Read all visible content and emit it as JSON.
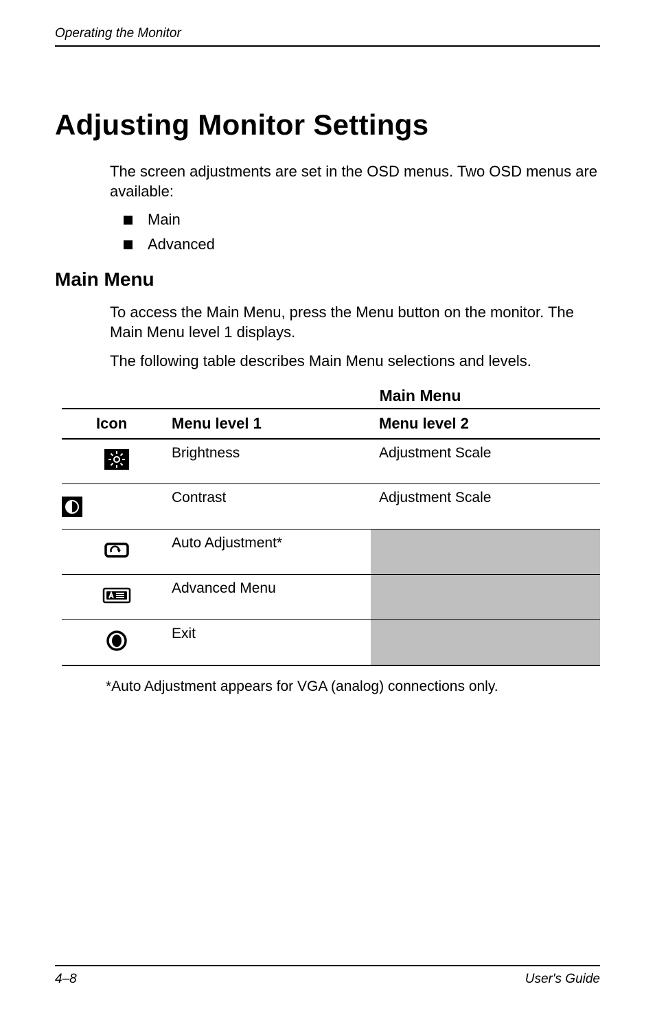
{
  "running_header": "Operating the Monitor",
  "h1": "Adjusting Monitor Settings",
  "intro": "The screen adjustments are set in the OSD menus. Two OSD menus are available:",
  "bullets": [
    "Main",
    "Advanced"
  ],
  "h2": "Main Menu",
  "main_para1": "To access the Main Menu, press the Menu button on the monitor. The Main Menu level 1 displays.",
  "main_para2": "The following table describes Main Menu selections and levels.",
  "table": {
    "title": "Main Menu",
    "headers": {
      "icon": "Icon",
      "level1": "Menu level 1",
      "level2": "Menu level 2"
    },
    "rows": [
      {
        "icon": "brightness",
        "level1": "Brightness",
        "level2": "Adjustment Scale"
      },
      {
        "icon": "contrast",
        "level1": "Contrast",
        "level2": "Adjustment Scale"
      },
      {
        "icon": "auto",
        "level1": "Auto Adjustment*",
        "level2": ""
      },
      {
        "icon": "advanced",
        "level1": "Advanced Menu",
        "level2": ""
      },
      {
        "icon": "exit",
        "level1": "Exit",
        "level2": ""
      }
    ]
  },
  "footnote": "*Auto Adjustment appears for VGA (analog) connections only.",
  "footer": {
    "left": "4–8",
    "right": "User's Guide"
  }
}
